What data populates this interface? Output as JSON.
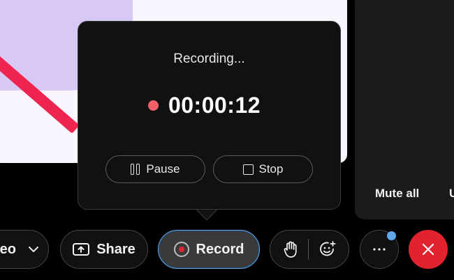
{
  "recording_popover": {
    "status": "Recording...",
    "elapsed": "00:00:12",
    "pause_label": "Pause",
    "stop_label": "Stop"
  },
  "participants_panel": {
    "mute_all_label": "Mute all",
    "unmute_all_label_clipped": "U"
  },
  "toolbar": {
    "video_label_clipped": "leo",
    "share_label": "Share",
    "record_label": "Record",
    "record_active": true,
    "more_has_notification": true
  },
  "icons": {
    "video_dropdown": "chevron-down-icon",
    "share": "share-screen-icon",
    "record": "record-icon",
    "raise_hand": "raise-hand-icon",
    "reactions": "add-reaction-icon",
    "more": "more-icon",
    "leave": "close-icon",
    "pause": "pause-icon",
    "stop": "stop-icon"
  },
  "colors": {
    "recording_dot": "#f0606b",
    "record_button_outline": "#6aa9e0",
    "leave_button": "#e2222f",
    "notification_dot": "#5fa8ea",
    "video_muted_slash": "#f0254f",
    "avatar_blob": "#d8c8f6"
  }
}
